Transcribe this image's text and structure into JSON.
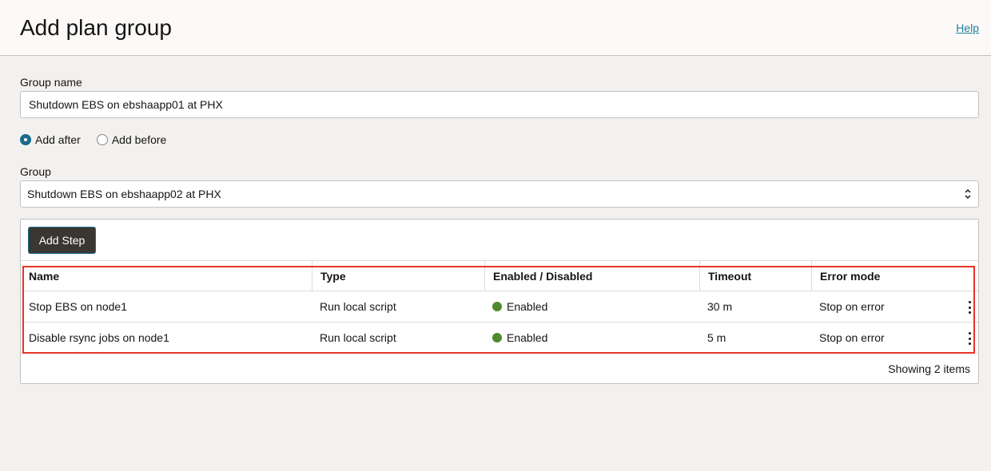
{
  "header": {
    "title": "Add plan group",
    "help_label": "Help"
  },
  "form": {
    "group_name_label": "Group name",
    "group_name_value": "Shutdown EBS on ebshaapp01 at PHX",
    "position_options": [
      {
        "label": "Add after",
        "checked": true
      },
      {
        "label": "Add before",
        "checked": false
      }
    ],
    "group_label": "Group",
    "group_selected": "Shutdown EBS on ebshaapp02 at PHX"
  },
  "steps": {
    "add_button_label": "Add Step",
    "columns": [
      "Name",
      "Type",
      "Enabled / Disabled",
      "Timeout",
      "Error mode"
    ],
    "rows": [
      {
        "name": "Stop EBS on node1",
        "type": "Run local script",
        "status": "Enabled",
        "timeout": "30 m",
        "error_mode": "Stop on error"
      },
      {
        "name": "Disable rsync jobs on node1",
        "type": "Run local script",
        "status": "Enabled",
        "timeout": "5 m",
        "error_mode": "Stop on error"
      }
    ],
    "footer": "Showing 2 items"
  },
  "colors": {
    "accent": "#1a6a8c",
    "enabled_status": "#508a2e",
    "highlight_border": "#e8332a",
    "link": "#227e9e"
  },
  "icons": [
    "radio-button-icon",
    "chevron-updown-icon",
    "status-dot-icon",
    "kebab-menu-icon"
  ]
}
